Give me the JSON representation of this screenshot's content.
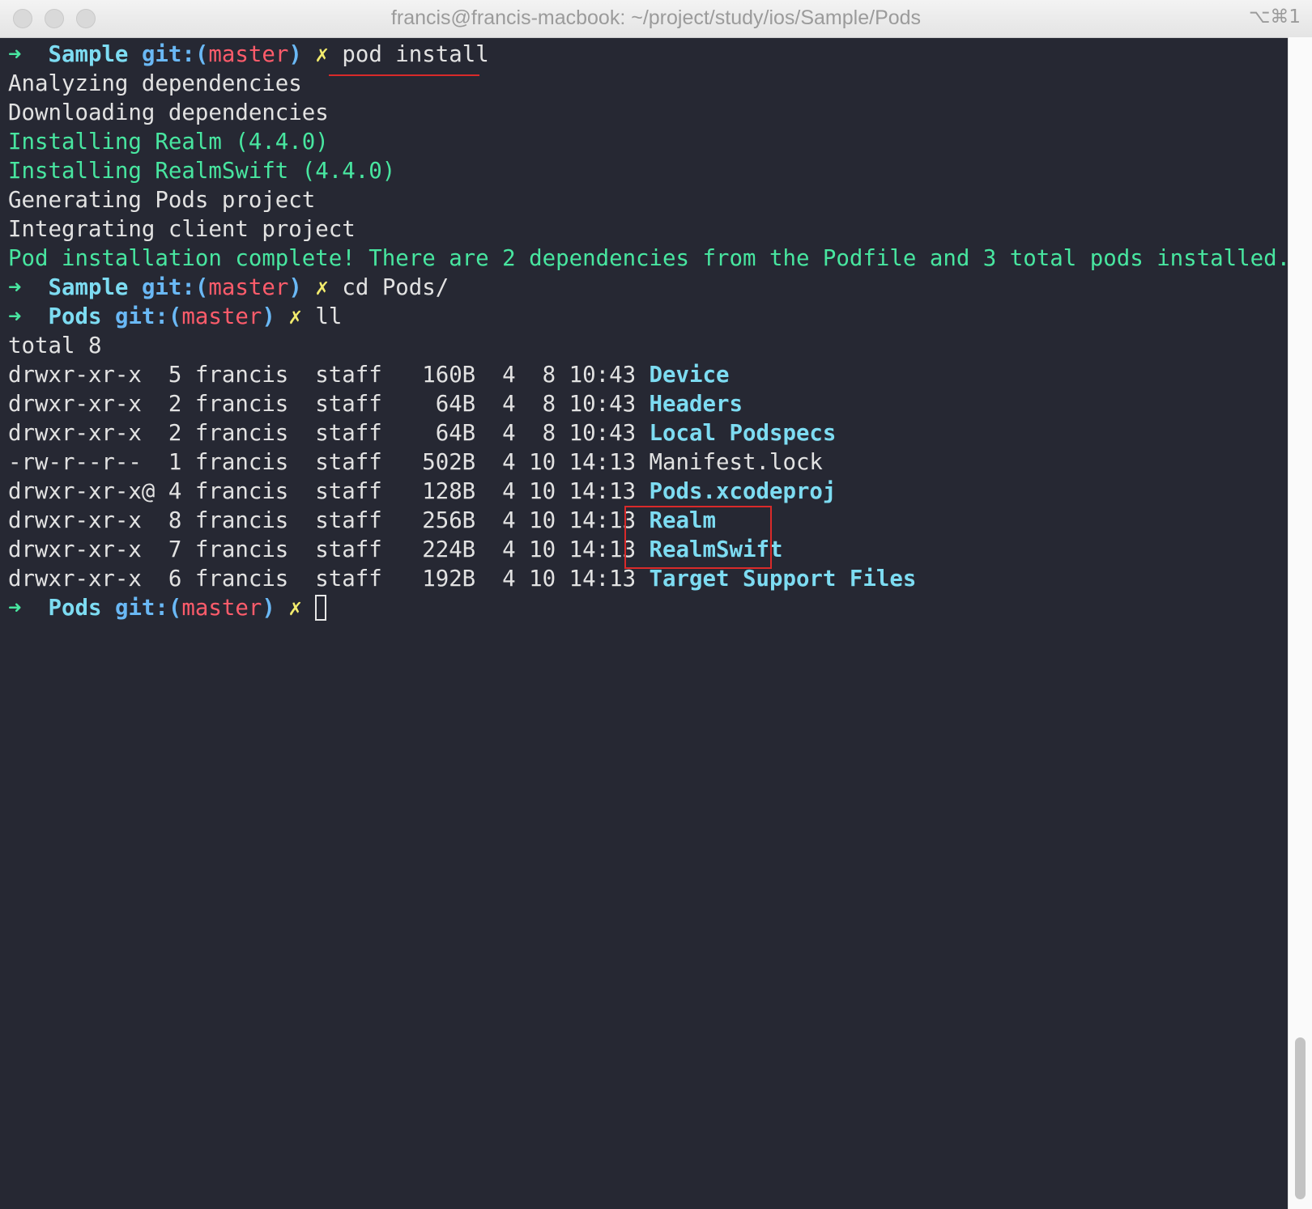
{
  "window": {
    "title": "francis@francis-macbook: ~/project/study/ios/Sample/Pods",
    "shortcut": "⌥⌘1"
  },
  "colors": {
    "background": "#262833",
    "prompt_arrow": "#48e6a0",
    "prompt_dir": "#7ddcf2",
    "git_label": "#6ab8f5",
    "branch": "#ff5c6b",
    "dirty_marker": "#f3ec6d",
    "success_text": "#48e6a0",
    "annotation": "#d92a2a"
  },
  "terminal": {
    "prompt1": {
      "arrow": "➜",
      "dir": "Sample",
      "git": "git:(",
      "branch": "master",
      "git_close": ")",
      "dirty": "✗",
      "command": "pod install"
    },
    "output": [
      "Analyzing dependencies",
      "Downloading dependencies",
      "Installing Realm (4.4.0)",
      "Installing RealmSwift (4.4.0)",
      "Generating Pods project",
      "Integrating client project",
      "Pod installation complete! There are 2 dependencies from the Podfile and 3 total pods installed."
    ],
    "prompt2": {
      "arrow": "➜",
      "dir": "Sample",
      "git": "git:(",
      "branch": "master",
      "git_close": ")",
      "dirty": "✗",
      "command": "cd Pods/"
    },
    "prompt3": {
      "arrow": "➜",
      "dir": "Pods",
      "git": "git:(",
      "branch": "master",
      "git_close": ")",
      "dirty": "✗",
      "command": "ll"
    },
    "listing_total": "total 8",
    "listing": [
      {
        "meta": "drwxr-xr-x  5 francis  staff   160B  4  8 10:43 ",
        "name": "Device"
      },
      {
        "meta": "drwxr-xr-x  2 francis  staff    64B  4  8 10:43 ",
        "name": "Headers"
      },
      {
        "meta": "drwxr-xr-x  2 francis  staff    64B  4  8 10:43 ",
        "name": "Local Podspecs"
      },
      {
        "meta": "-rw-r--r--  1 francis  staff   502B  4 10 14:13 ",
        "name": "Manifest.lock"
      },
      {
        "meta": "drwxr-xr-x@ 4 francis  staff   128B  4 10 14:13 ",
        "name": "Pods.xcodeproj"
      },
      {
        "meta": "drwxr-xr-x  8 francis  staff   256B  4 10 14:13 ",
        "name": "Realm"
      },
      {
        "meta": "drwxr-xr-x  7 francis  staff   224B  4 10 14:13 ",
        "name": "RealmSwift"
      },
      {
        "meta": "drwxr-xr-x  6 francis  staff   192B  4 10 14:13 ",
        "name": "Target Support Files"
      }
    ],
    "prompt4": {
      "arrow": "➜",
      "dir": "Pods",
      "git": "git:(",
      "branch": "master",
      "git_close": ")",
      "dirty": "✗"
    }
  }
}
